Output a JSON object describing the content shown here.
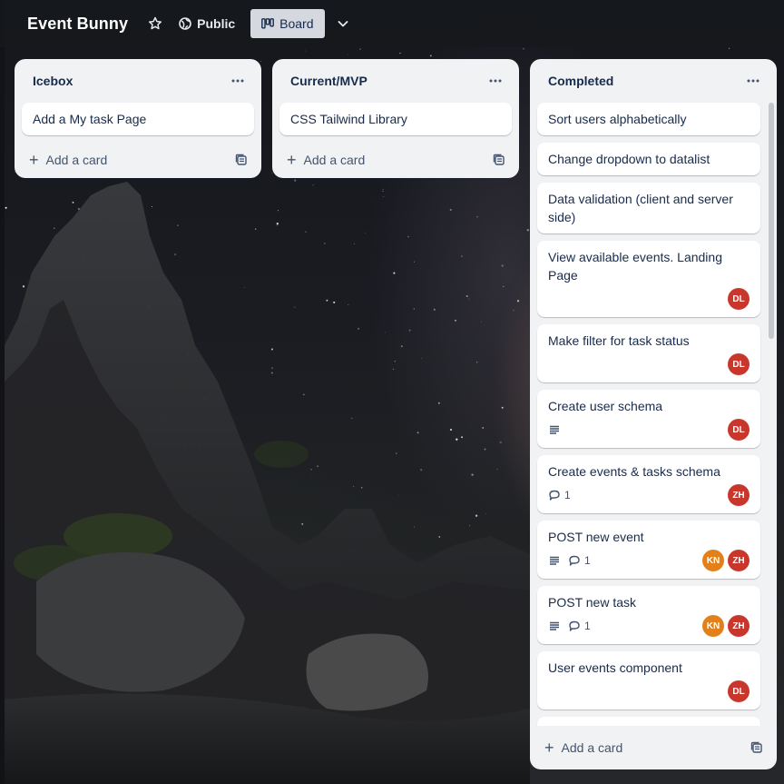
{
  "header": {
    "board_title": "Event Bunny",
    "visibility_label": "Public",
    "view_label": "Board"
  },
  "lists": [
    {
      "title": "Icebox",
      "cards": [
        {
          "title": "Add a My task Page"
        }
      ],
      "add_card_label": "Add a card"
    },
    {
      "title": "Current/MVP",
      "cards": [
        {
          "title": "CSS Tailwind Library"
        }
      ],
      "add_card_label": "Add a card"
    },
    {
      "title": "Completed",
      "cards": [
        {
          "title": "Sort users alphabetically"
        },
        {
          "title": "Change dropdown to datalist"
        },
        {
          "title": "Data validation (client and server side)"
        },
        {
          "title": "View available events. Landing Page",
          "members": [
            "DL"
          ]
        },
        {
          "title": "Make filter for task status",
          "members": [
            "DL"
          ]
        },
        {
          "title": "Create user schema",
          "description": true,
          "members": [
            "DL"
          ]
        },
        {
          "title": "Create events & tasks schema",
          "comments": "1",
          "members": [
            "ZH"
          ]
        },
        {
          "title": "POST new event",
          "description": true,
          "comments": "1",
          "members": [
            "KN",
            "ZH"
          ]
        },
        {
          "title": "POST new task",
          "description": true,
          "comments": "1",
          "members": [
            "KN",
            "ZH"
          ]
        },
        {
          "title": "User events component",
          "members": [
            "DL"
          ]
        }
      ],
      "add_card_label": "Add a card"
    }
  ],
  "avatar_colors": {
    "DL": "#c9372c",
    "ZH": "#c9372c",
    "KN": "#e2811a"
  },
  "colors": {
    "list_bg": "#f1f2f4",
    "card_bg": "#ffffff",
    "text_primary": "#172b4d",
    "text_subtle": "#44546f",
    "header_bg": "#16181c",
    "view_button_bg": "#d5d8de"
  },
  "icons": {
    "star": "star-icon",
    "public": "globe-icon",
    "board": "board-icon",
    "chevron": "chevron-down-icon",
    "list_menu": "ellipsis-icon",
    "add": "plus-icon",
    "template": "card-template-icon",
    "description": "description-icon",
    "comment": "comment-icon"
  }
}
